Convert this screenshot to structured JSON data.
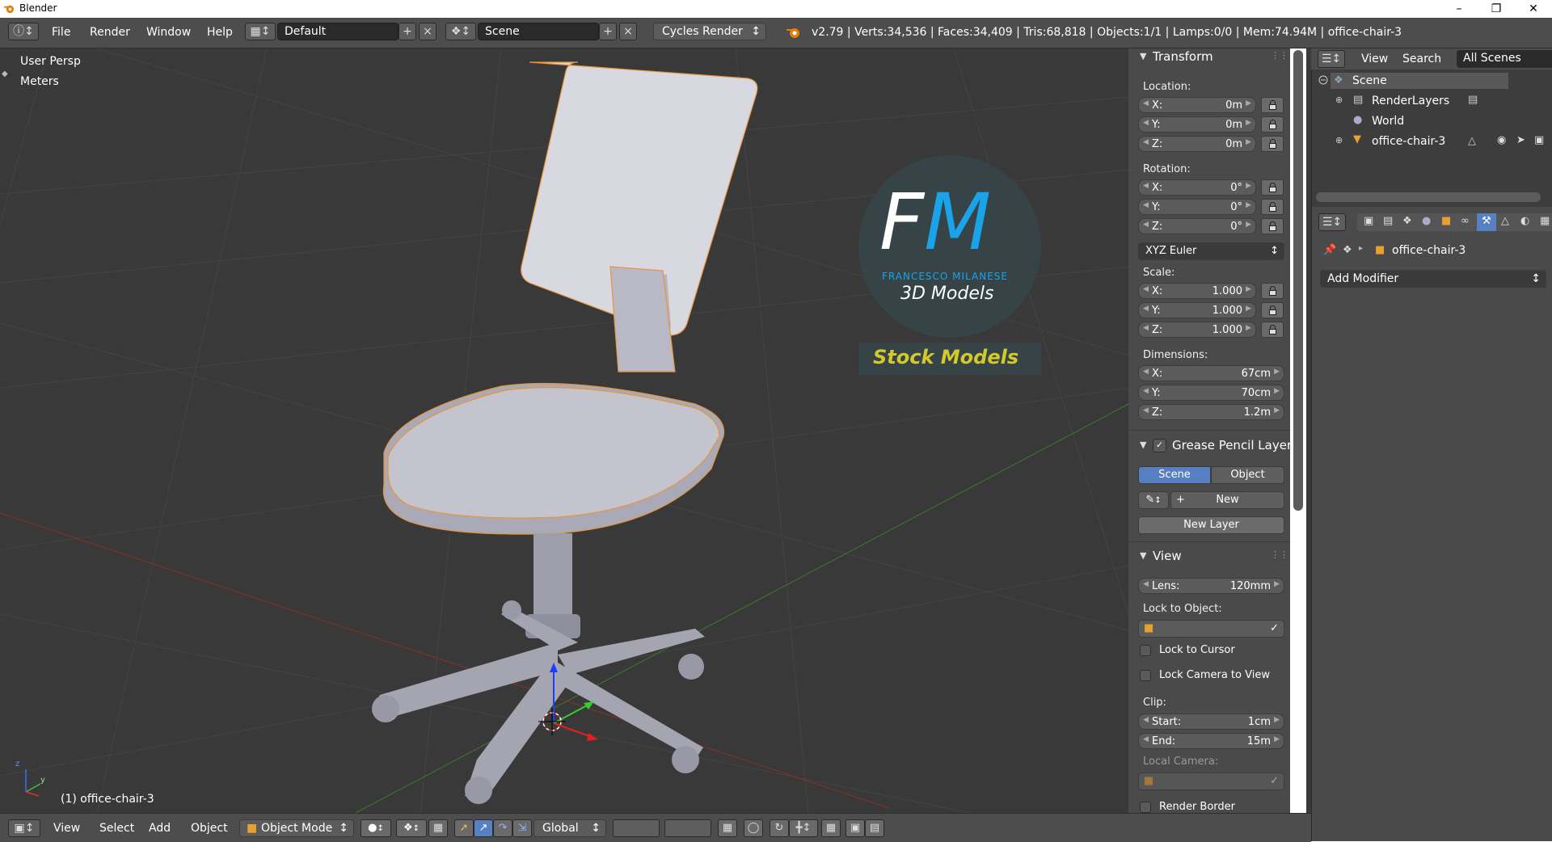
{
  "window": {
    "title": "Blender"
  },
  "info_header": {
    "menus": [
      "File",
      "Render",
      "Window",
      "Help"
    ],
    "screen_layout": "Default",
    "scene": "Scene",
    "render_engine": "Cycles Render",
    "stats": "v2.79 | Verts:34,536 | Faces:34,409 | Tris:68,818 | Objects:1/1 | Lamps:0/0 | Mem:74.94M | office-chair-3"
  },
  "viewport": {
    "view_name": "User Persp",
    "units": "Meters",
    "active_object": "(1) office-chair-3",
    "watermark": {
      "initials_left": "F",
      "initials_right": "M",
      "author": "FRANCESCO MILANESE",
      "subtitle": "3D Models",
      "tagline": "Stock Models"
    }
  },
  "npanel": {
    "transform": {
      "title": "Transform",
      "location_label": "Location:",
      "location": [
        {
          "axis": "X:",
          "value": "0m"
        },
        {
          "axis": "Y:",
          "value": "0m"
        },
        {
          "axis": "Z:",
          "value": "0m"
        }
      ],
      "rotation_label": "Rotation:",
      "rotation": [
        {
          "axis": "X:",
          "value": "0°"
        },
        {
          "axis": "Y:",
          "value": "0°"
        },
        {
          "axis": "Z:",
          "value": "0°"
        }
      ],
      "rotation_mode": "XYZ Euler",
      "scale_label": "Scale:",
      "scale": [
        {
          "axis": "X:",
          "value": "1.000"
        },
        {
          "axis": "Y:",
          "value": "1.000"
        },
        {
          "axis": "Z:",
          "value": "1.000"
        }
      ],
      "dimensions_label": "Dimensions:",
      "dimensions": [
        {
          "axis": "X:",
          "value": "67cm"
        },
        {
          "axis": "Y:",
          "value": "70cm"
        },
        {
          "axis": "Z:",
          "value": "1.2m"
        }
      ]
    },
    "grease_pencil": {
      "title": "Grease Pencil Layer",
      "tab_scene": "Scene",
      "tab_object": "Object",
      "new_label": "New",
      "new_layer_label": "New Layer"
    },
    "view": {
      "title": "View",
      "lens_label": "Lens:",
      "lens_value": "120mm",
      "lock_to_object_label": "Lock to Object:",
      "lock_to_cursor": "Lock to Cursor",
      "lock_camera_to_view": "Lock Camera to View",
      "clip_label": "Clip:",
      "clip_start_label": "Start:",
      "clip_start": "1cm",
      "clip_end_label": "End:",
      "clip_end": "15m",
      "local_camera_label": "Local Camera:",
      "render_border": "Render Border"
    }
  },
  "outliner": {
    "menus": [
      "View",
      "Search"
    ],
    "filter": "All Scenes",
    "items": [
      "Scene",
      "RenderLayers",
      "World",
      "office-chair-3"
    ]
  },
  "properties": {
    "object_name": "office-chair-3",
    "add_modifier": "Add Modifier"
  },
  "bottom_header": {
    "menus": [
      "View",
      "Select",
      "Add",
      "Object"
    ],
    "mode": "Object Mode",
    "orientation": "Global"
  }
}
